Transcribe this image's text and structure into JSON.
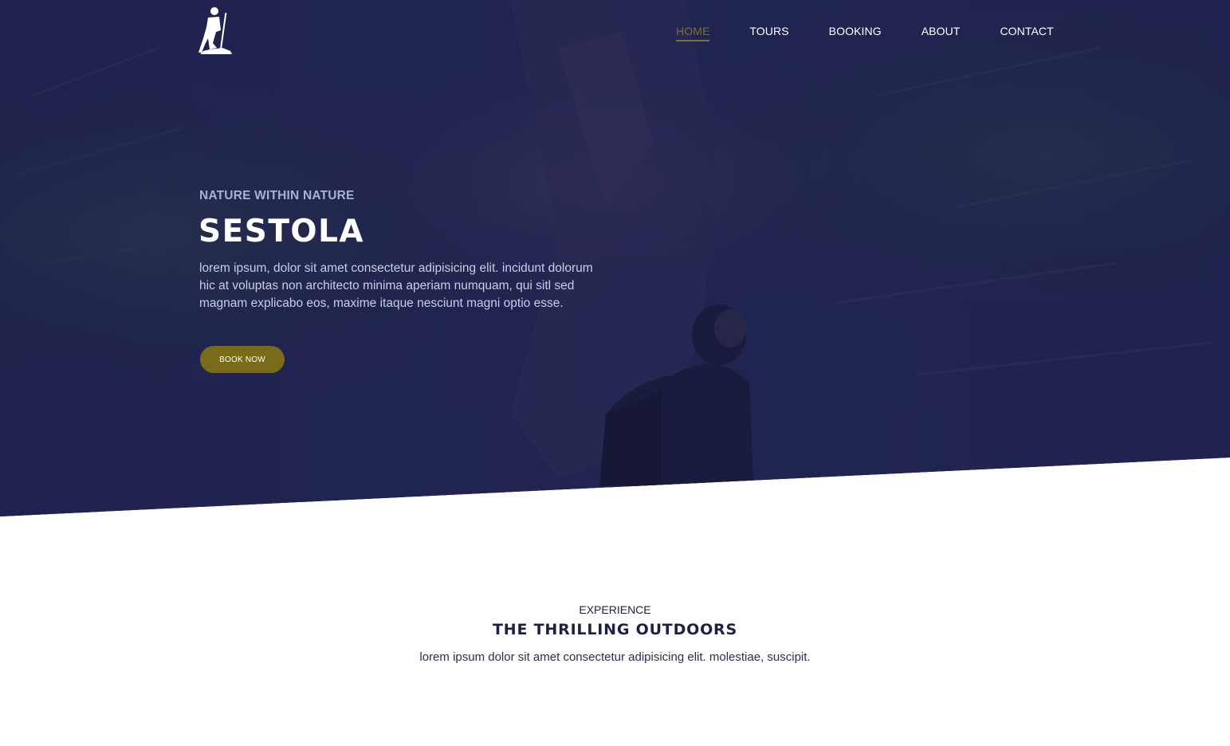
{
  "nav": {
    "logo_icon": "hiker-icon",
    "items": [
      {
        "label": "HOME",
        "active": true
      },
      {
        "label": "TOURS",
        "active": false
      },
      {
        "label": "BOOKING",
        "active": false
      },
      {
        "label": "ABOUT",
        "active": false
      },
      {
        "label": "CONTACT",
        "active": false
      }
    ]
  },
  "hero": {
    "kicker": "NATURE WITHIN NATURE",
    "title": "SESTOLA",
    "text": "lorem ipsum, dolor sit amet consectetur adipisicing elit. incidunt dolorum hic at voluptas non architecto minima aperiam numquam, qui sitl sed magnam explicabo eos, maxime itaque nesciunt magni optio esse.",
    "button_label": "BOOK NOW"
  },
  "experience": {
    "kicker": "EXPERIENCE",
    "title": "THE THRILLING OUTDOORS",
    "text": "lorem ipsum dolor sit amet consectetur adipisicing elit. molestiae, suscipit."
  },
  "colors": {
    "hero_overlay": "#1c2047",
    "accent": "#7a6b1a",
    "active_nav": "#7a7130",
    "heading_dark": "#1d2044",
    "kicker_light": "#a7b1d8"
  }
}
